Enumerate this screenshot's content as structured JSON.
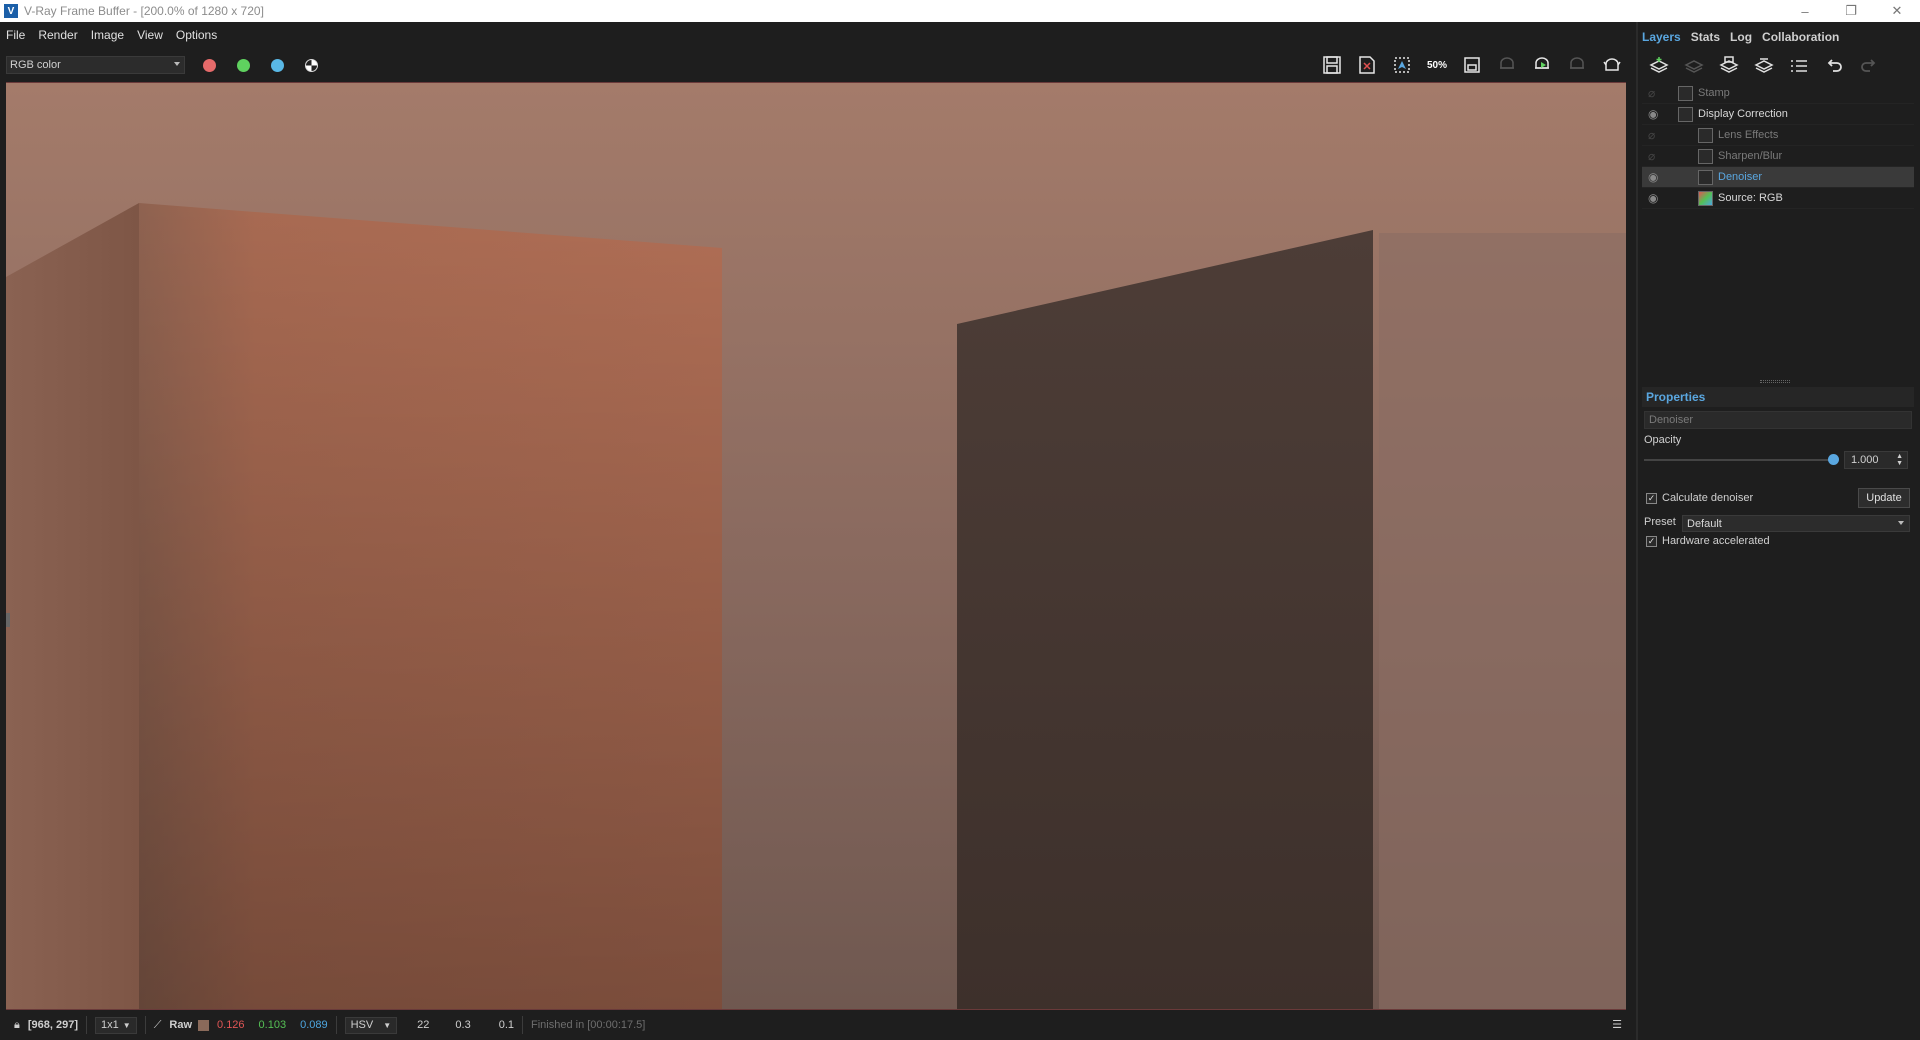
{
  "window": {
    "title": "V-Ray Frame Buffer - [200.0% of 1280 x 720]",
    "app_icon": "V",
    "controls": [
      "–",
      "❐",
      "✕"
    ]
  },
  "menu": [
    "File",
    "Render",
    "Image",
    "View",
    "Options"
  ],
  "toolbar": {
    "channel": "RGB color",
    "channels": {
      "red": "#e56a6a",
      "green": "#5fd15f",
      "blue": "#59b8e6"
    },
    "zoom_badge": "50%",
    "icons": [
      "save-icon",
      "clear-image-icon",
      "region-render-icon",
      "zoom-50-icon",
      "track-mouse-icon",
      "interactive-render-icon",
      "render-icon",
      "stop-render-icon",
      "teapot-render-icon"
    ]
  },
  "status": {
    "coords": "[968, 297]",
    "sample": "1x1",
    "mode": "Raw",
    "r": "0.126",
    "g": "0.103",
    "b": "0.089",
    "color_space": "HSV",
    "h": "22",
    "s": "0.3",
    "v": "0.1",
    "message": "Finished in [00:00:17.5]",
    "colors": {
      "r": "#e05555",
      "g": "#55c055",
      "b": "#4da6e0",
      "swatch": "#8a6a5a"
    }
  },
  "panel": {
    "tabs": [
      "Layers",
      "Stats",
      "Log",
      "Collaboration"
    ],
    "active_tab": "Layers",
    "layers": [
      {
        "name": "Stamp",
        "visible": false,
        "indent": 0
      },
      {
        "name": "Display Correction",
        "visible": true,
        "indent": 0
      },
      {
        "name": "Lens Effects",
        "visible": false,
        "indent": 1
      },
      {
        "name": "Sharpen/Blur",
        "visible": false,
        "indent": 1
      },
      {
        "name": "Denoiser",
        "visible": true,
        "indent": 1,
        "selected": true
      },
      {
        "name": "Source: RGB",
        "visible": true,
        "indent": 1
      }
    ],
    "properties": {
      "header": "Properties",
      "layer_name": "Denoiser",
      "opacity_label": "Opacity",
      "opacity_value": "1.000",
      "opacity_fraction": 1.0,
      "calculate_label": "Calculate denoiser",
      "calculate_checked": true,
      "update_label": "Update",
      "preset_label": "Preset",
      "preset_value": "Default",
      "hw_label": "Hardware accelerated",
      "hw_checked": true
    }
  }
}
